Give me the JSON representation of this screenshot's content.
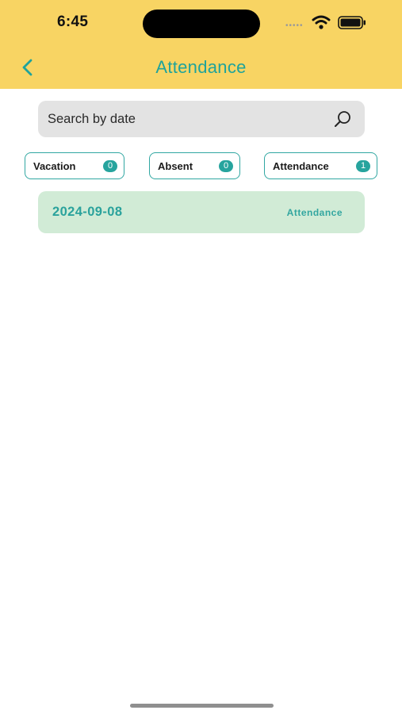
{
  "status_bar": {
    "time": "6:45",
    "cell_dots": "•••••"
  },
  "header": {
    "title": "Attendance"
  },
  "search": {
    "placeholder": "Search by date"
  },
  "filters": [
    {
      "label": "Vacation",
      "count": "0"
    },
    {
      "label": "Absent",
      "count": "0"
    },
    {
      "label": "Attendance",
      "count": "1"
    }
  ],
  "records": [
    {
      "date": "2024-09-08",
      "status": "Attendance"
    }
  ],
  "colors": {
    "header_bg": "#f8d463",
    "accent": "#1fa39b",
    "record_bg": "#d1ebd6",
    "search_bg": "#e3e3e3"
  },
  "icons": {
    "back": "chevron-left-icon",
    "search": "search-icon",
    "wifi": "wifi-icon",
    "battery": "battery-icon"
  }
}
